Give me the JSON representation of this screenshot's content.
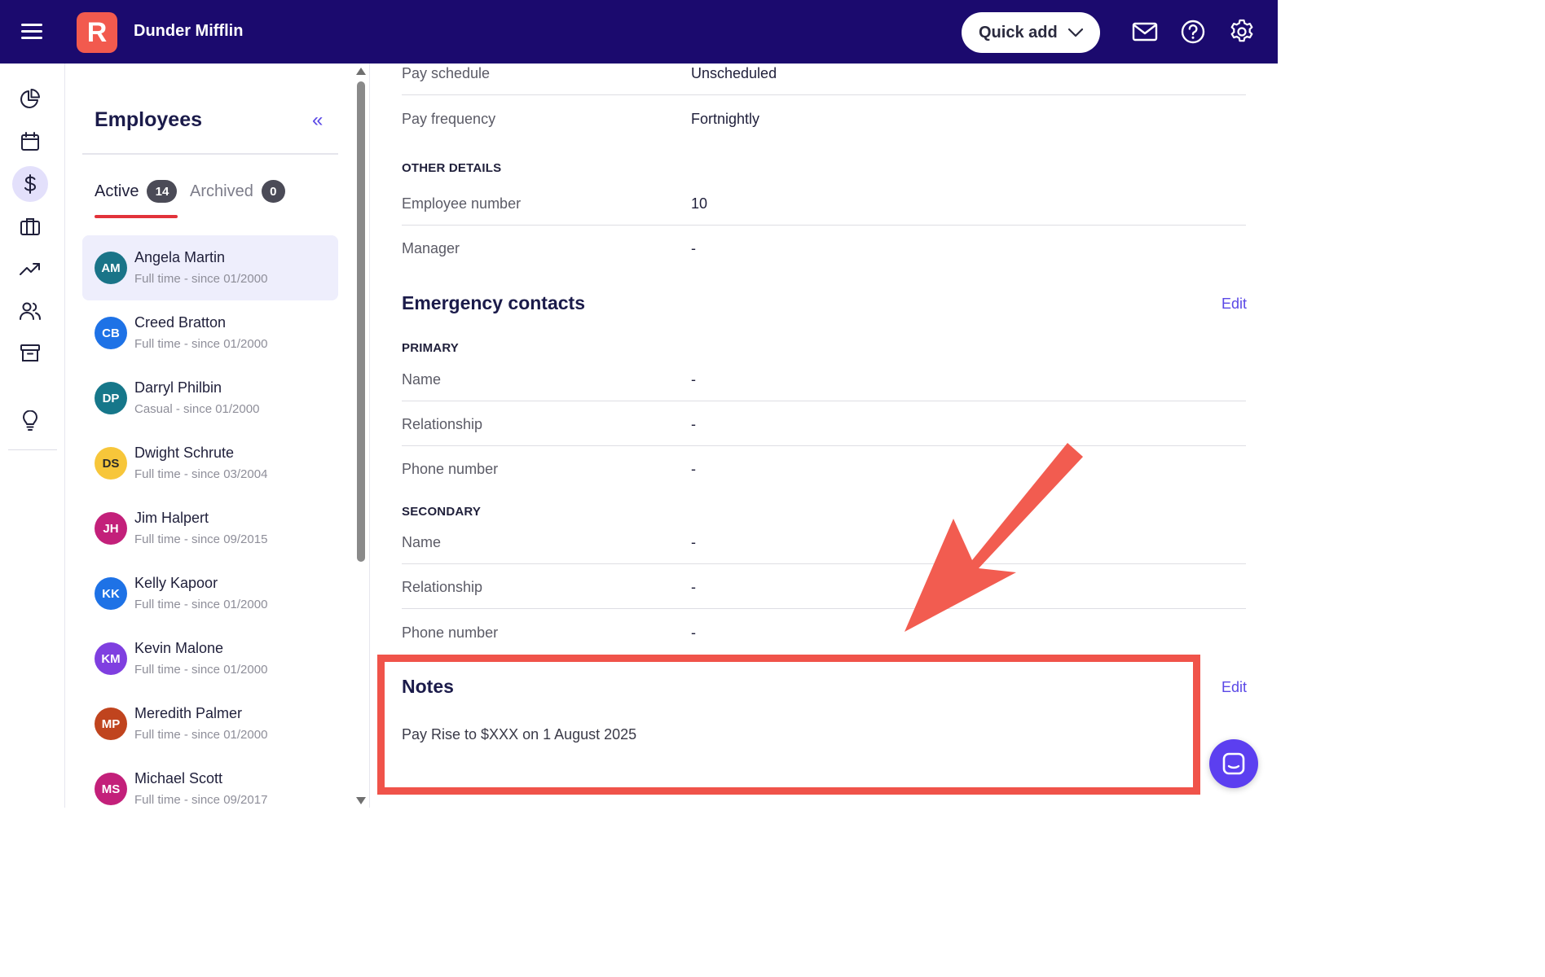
{
  "header": {
    "logo_letter": "R",
    "company": "Dunder Mifflin",
    "quick_add": "Quick add"
  },
  "rail": {
    "icons": [
      "pie-chart-icon",
      "calendar-icon",
      "dollar-icon",
      "briefcase-icon",
      "trending-up-icon",
      "users-icon",
      "archive-icon",
      "lightbulb-icon"
    ],
    "active": "dollar-icon"
  },
  "employees": {
    "title": "Employees",
    "collapse": "«",
    "tabs": {
      "active_label": "Active",
      "active_count": "14",
      "archived_label": "Archived",
      "archived_count": "0"
    },
    "list": [
      {
        "initials": "AM",
        "name": "Angela Martin",
        "sub": "Full time - since 01/2000",
        "color": "#1a7488"
      },
      {
        "initials": "CB",
        "name": "Creed Bratton",
        "sub": "Full time - since 01/2000",
        "color": "#1e72e6"
      },
      {
        "initials": "DP",
        "name": "Darryl Philbin",
        "sub": "Casual - since 01/2000",
        "color": "#16778a"
      },
      {
        "initials": "DS",
        "name": "Dwight Schrute",
        "sub": "Full time - since 03/2004",
        "color": "#f7c63a"
      },
      {
        "initials": "JH",
        "name": "Jim Halpert",
        "sub": "Full time - since 09/2015",
        "color": "#c3207a"
      },
      {
        "initials": "KK",
        "name": "Kelly Kapoor",
        "sub": "Full time - since 01/2000",
        "color": "#1e72e6"
      },
      {
        "initials": "KM",
        "name": "Kevin Malone",
        "sub": "Full time - since 01/2000",
        "color": "#7f3fe0"
      },
      {
        "initials": "MP",
        "name": "Meredith Palmer",
        "sub": "Full time - since 01/2000",
        "color": "#c0441e"
      },
      {
        "initials": "MS",
        "name": "Michael Scott",
        "sub": "Full time - since 09/2017",
        "color": "#c3207a"
      }
    ]
  },
  "details": {
    "pay_schedule_label": "Pay schedule",
    "pay_schedule_value": "Unscheduled",
    "pay_frequency_label": "Pay frequency",
    "pay_frequency_value": "Fortnightly",
    "other_details": "OTHER DETAILS",
    "employee_number_label": "Employee number",
    "employee_number_value": "10",
    "manager_label": "Manager",
    "manager_value": "-"
  },
  "emergency": {
    "title": "Emergency contacts",
    "edit": "Edit",
    "primary": "PRIMARY",
    "secondary": "SECONDARY",
    "name_label": "Name",
    "relationship_label": "Relationship",
    "phone_label": "Phone number",
    "empty": "-"
  },
  "notes": {
    "title": "Notes",
    "edit": "Edit",
    "text": "Pay Rise to $XXX on 1 August 2025"
  },
  "colors": {
    "header_bg": "#1b0a6e",
    "accent": "#5a48e6",
    "brand": "#f25a4e",
    "annotation": "#f0534a"
  }
}
